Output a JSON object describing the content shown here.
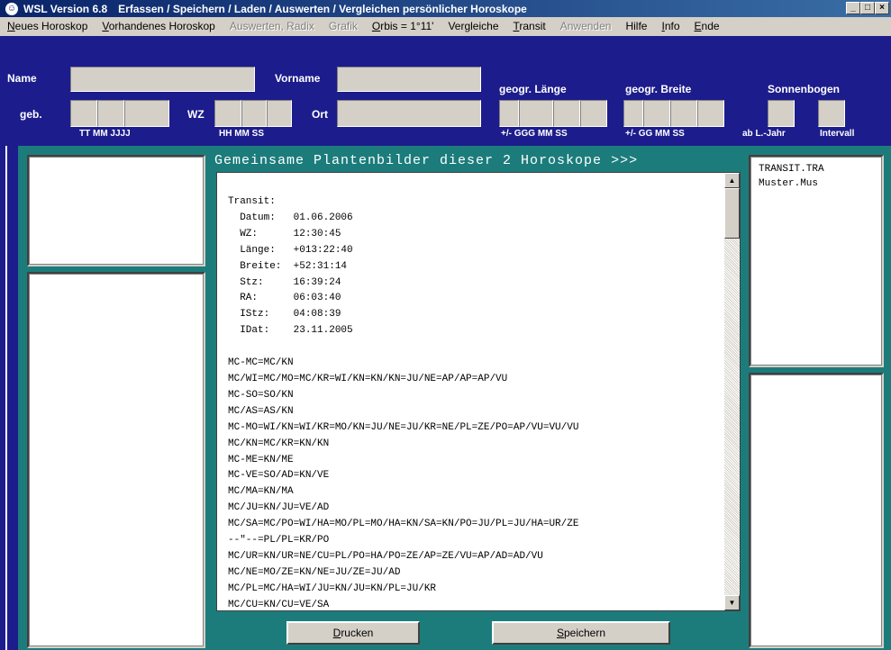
{
  "window": {
    "app_name": "WSL Version 6.8",
    "caption": "Erfassen / Speichern / Laden / Auswerten / Vergleichen persönlicher Horoskope",
    "minimize": "_",
    "maximize": "□",
    "close": "×"
  },
  "menu": [
    {
      "first": "N",
      "rest": "eues Horoskop",
      "disabled": false
    },
    {
      "first": "V",
      "rest": "orhandenes Horoskop",
      "disabled": false
    },
    {
      "first": "",
      "rest": "Auswerten, Radix",
      "disabled": true
    },
    {
      "first": "",
      "rest": "Grafik",
      "disabled": true
    },
    {
      "first": "O",
      "rest": "rbis = 1°11'",
      "disabled": false
    },
    {
      "first": "",
      "rest": "Vergleiche",
      "disabled": false
    },
    {
      "first": "T",
      "rest": "ransit",
      "disabled": false
    },
    {
      "first": "",
      "rest": "Anwenden",
      "disabled": true
    },
    {
      "first": "",
      "rest": "Hilfe",
      "disabled": false
    },
    {
      "first": "I",
      "rest": "nfo",
      "disabled": false
    },
    {
      "first": "E",
      "rest": "nde",
      "disabled": false
    }
  ],
  "header": {
    "name_label": "Name",
    "vorname_label": "Vorname",
    "geb_label": "geb.",
    "wz_label": "WZ",
    "ort_label": "Ort",
    "laenge_label": "geogr. Länge",
    "breite_label": "geogr. Breite",
    "sonnenbogen_label": "Sonnenbogen",
    "date_sub": "TT  MM   JJJJ",
    "time_sub": "HH  MM  SS",
    "laenge_sub": "+/-  GGG  MM  SS",
    "breite_sub": "+/-  GG  MM  SS",
    "abljahr_sub": "ab L.-Jahr",
    "intervall_sub": "Intervall"
  },
  "center_title": "Gemeinsame Plantenbilder dieser 2 Horoskope >>>",
  "text_lines": [
    "Transit:",
    "  Datum:   01.06.2006",
    "  WZ:      12:30:45",
    "  Länge:   +013:22:40",
    "  Breite:  +52:31:14",
    "  Stz:     16:39:24",
    "  RA:      06:03:40",
    "  IStz:    04:08:39",
    "  IDat:    23.11.2005",
    "",
    "MC-MC=MC/KN",
    "MC/WI=MC/MO=MC/KR=WI/KN=KN/KN=JU/NE=AP/AP=AP/VU",
    "MC-SO=SO/KN",
    "MC/AS=AS/KN",
    "MC-MO=WI/KN=WI/KR=MO/KN=JU/NE=JU/KR=NE/PL=ZE/PO=AP/VU=VU/VU",
    "MC/KN=MC/KR=KN/KN",
    "MC-ME=KN/ME",
    "MC-VE=SO/AD=KN/VE",
    "MC/MA=KN/MA",
    "MC/JU=KN/JU=VE/AD",
    "MC/SA=MC/PO=WI/HA=MO/PL=MO/HA=KN/SA=KN/PO=JU/PL=JU/HA=UR/ZE",
    "--\"--=PL/PL=KR/PO",
    "MC/UR=KN/UR=NE/CU=PL/PO=HA/PO=ZE/AP=ZE/VU=AP/AD=AD/VU",
    "MC/NE=MO/ZE=KN/NE=JU/ZE=JU/AD",
    "MC/PL=MC/HA=WI/JU=KN/JU=KN/PL=JU/KR",
    "MC/CU=KN/CU=VE/SA"
  ],
  "file_list": [
    "TRANSIT.TRA",
    "Muster.Mus"
  ],
  "buttons": {
    "print_first": "D",
    "print_rest": "rucken",
    "save_first": "S",
    "save_rest": "peichern"
  },
  "scroll_up": "▲",
  "scroll_down": "▼"
}
